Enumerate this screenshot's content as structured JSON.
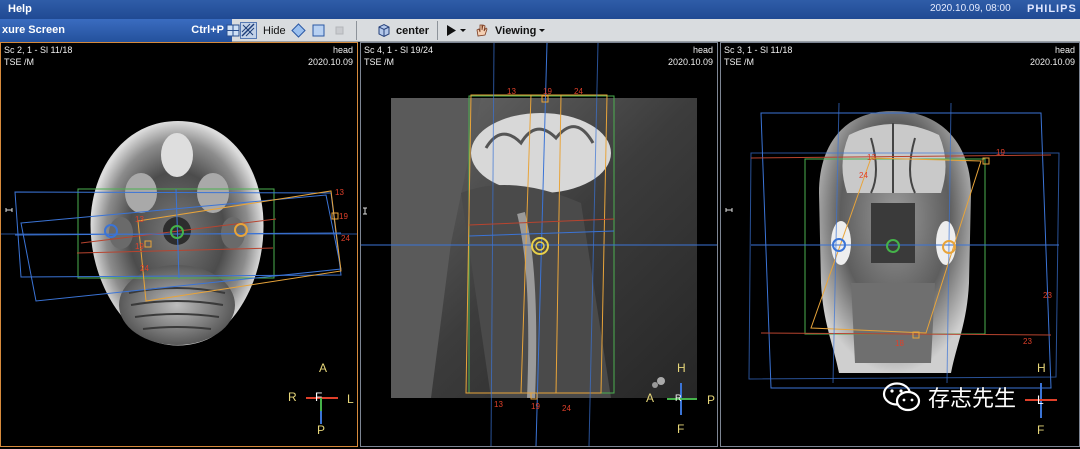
{
  "menu": {
    "help": "Help"
  },
  "status": {
    "datetime": "2020.10.09, 08:00",
    "brand": "PHILIPS"
  },
  "toolbar": {
    "caption_left": "xure Screen",
    "caption_shortcut": "Ctrl+P",
    "hide_label": "Hide",
    "center_label": "center",
    "viewing_label": "Viewing"
  },
  "viewports": [
    {
      "scan": "Sc 2, 1 - Sl 11/18",
      "seq": "TSE  /M",
      "anat": "head",
      "date": "2020.10.09",
      "ori": {
        "top": "A",
        "left": "R",
        "center": "F",
        "right": "L",
        "bottom": "P"
      },
      "nums": [
        "13",
        "19",
        "24",
        "19",
        "13",
        "24"
      ]
    },
    {
      "scan": "Sc 4, 1 - Sl 19/24",
      "seq": "TSE  /M",
      "anat": "head",
      "date": "2020.10.09",
      "ori": {
        "top": "H",
        "left": "A",
        "center": "R",
        "right": "P",
        "bottom": "F"
      },
      "nums": [
        "13",
        "19",
        "24",
        "13",
        "19",
        "24"
      ]
    },
    {
      "scan": "Sc 3, 1 - Sl 11/18",
      "seq": "TSE  /M",
      "anat": "head",
      "date": "2020.10.09",
      "ori": {
        "top": "H",
        "center": "L",
        "bottom": "F"
      },
      "nums": [
        "19",
        "23",
        "23",
        "13",
        "18",
        "24"
      ]
    }
  ],
  "watermark": {
    "text": "存志先生"
  },
  "colors": {
    "active_border": "#d68a3c",
    "stack_orange": "#e8a43a",
    "stack_blue": "#3b74d6",
    "stack_green": "#45b34a",
    "stack_red": "#b8442f",
    "label_red": "#e0402a"
  }
}
